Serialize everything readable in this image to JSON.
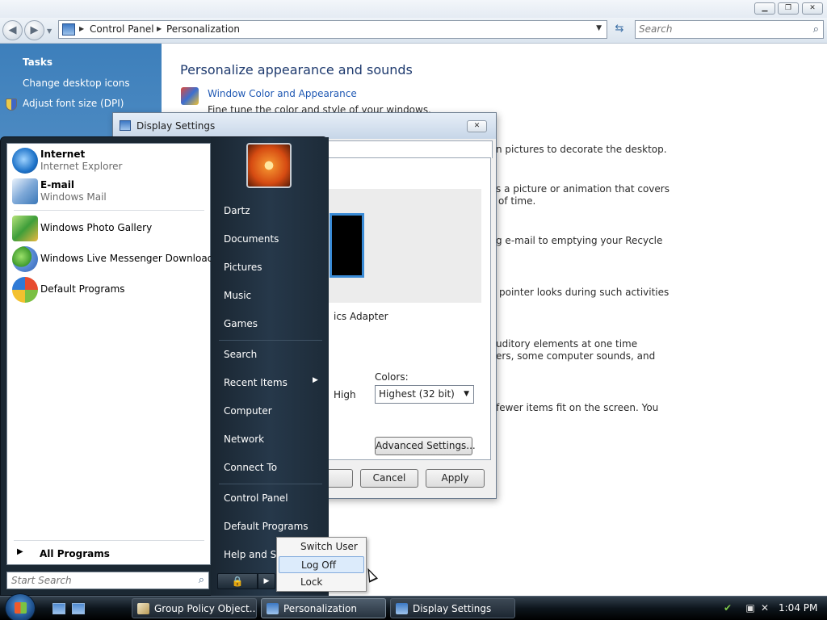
{
  "explorer": {
    "address": {
      "crumbs": [
        "Control Panel",
        "Personalization"
      ]
    },
    "search": {
      "placeholder": "Search"
    },
    "tasks": {
      "heading": "Tasks",
      "items": [
        "Change desktop icons",
        "Adjust font size (DPI)"
      ]
    },
    "main": {
      "heading": "Personalize appearance and sounds",
      "items": [
        {
          "link": "Window Color and Appearance",
          "desc": "Fine tune the color and style of your windows."
        },
        {
          "desc": "n pictures to decorate the desktop."
        },
        {
          "desc1": "s a picture or animation that covers",
          "desc2": "of time."
        },
        {
          "desc": "g e-mail to emptying your Recycle"
        },
        {
          "desc": "pointer looks during such activities"
        },
        {
          "desc1": "uditory elements at one time",
          "desc2": "ers, some computer sounds, and"
        },
        {
          "desc": "fewer items fit on the screen. You"
        }
      ]
    }
  },
  "dialog": {
    "title": "Display Settings",
    "adapter_text": "ics Adapter",
    "resolution_high_label": "High",
    "colors_label": "Colors:",
    "colors_value": "Highest (32 bit)",
    "advanced_button": "Advanced Settings...",
    "cancel_button": "Cancel",
    "apply_button": "Apply"
  },
  "start_menu": {
    "pinned": [
      {
        "title": "Internet",
        "subtitle": "Internet Explorer"
      },
      {
        "title": "E-mail",
        "subtitle": "Windows Mail"
      }
    ],
    "recent": [
      "Windows Photo Gallery",
      "Windows Live Messenger Download",
      "Default Programs"
    ],
    "all_programs": "All Programs",
    "search_placeholder": "Start Search",
    "right_items": [
      "Dartz",
      "Documents",
      "Pictures",
      "Music",
      "Games",
      "Search",
      "Recent Items",
      "Computer",
      "Network",
      "Connect To",
      "Control Panel",
      "Default Programs",
      "Help and Sup"
    ]
  },
  "power_menu": {
    "items": [
      "Switch User",
      "Log Off",
      "Lock"
    ],
    "highlighted": "Log Off"
  },
  "taskbar": {
    "buttons": [
      "Group Policy Object...",
      "Personalization",
      "Display Settings"
    ],
    "clock": "1:04 PM"
  }
}
